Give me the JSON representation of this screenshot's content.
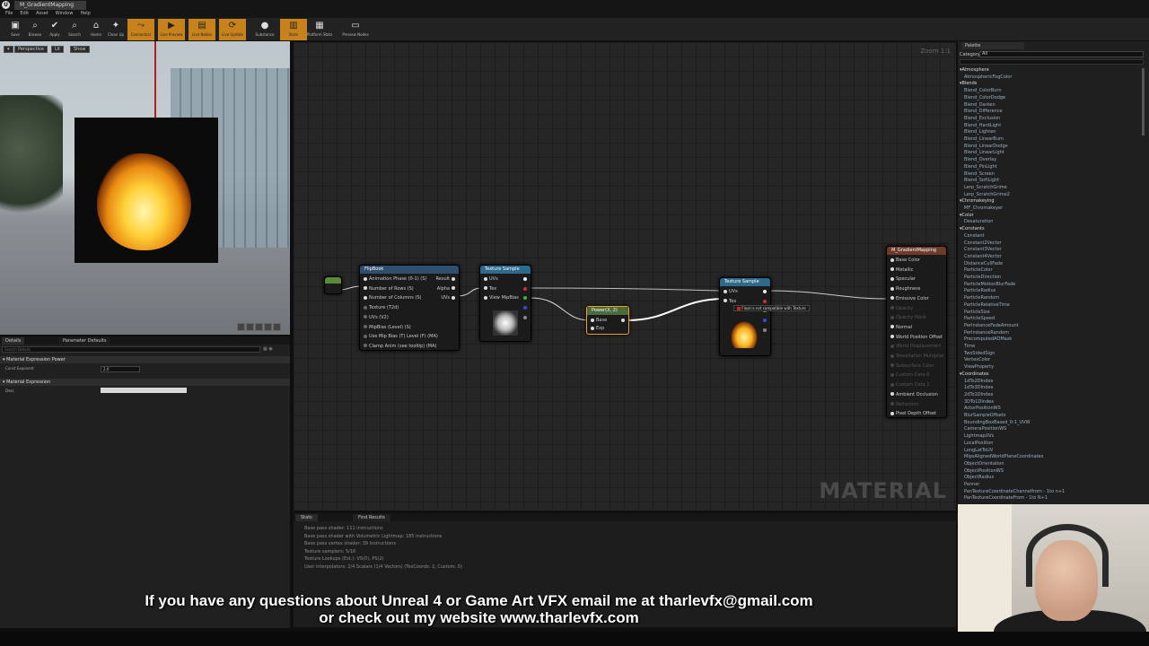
{
  "window": {
    "tab_title": "M_GradientMapping"
  },
  "menu": [
    "File",
    "Edit",
    "Asset",
    "Window",
    "Help"
  ],
  "toolbar": [
    {
      "label": "Save",
      "icon": "save-icon",
      "active": false
    },
    {
      "label": "Browse",
      "icon": "browse-icon",
      "active": false
    },
    {
      "label": "Apply",
      "icon": "apply-icon",
      "active": false
    },
    {
      "label": "Search",
      "icon": "search-icon",
      "active": false
    },
    {
      "label": "Home",
      "icon": "home-icon",
      "active": false
    },
    {
      "label": "Clean Up",
      "icon": "cleanup-icon",
      "active": false
    },
    {
      "label": "Connectors",
      "icon": "connectors-icon",
      "active": true
    },
    {
      "label": "Live Preview",
      "icon": "live-preview-icon",
      "active": true
    },
    {
      "label": "Live Nodes",
      "icon": "live-nodes-icon",
      "active": true
    },
    {
      "label": "Live Update",
      "icon": "live-update-icon",
      "active": true
    },
    {
      "label": "Substance",
      "icon": "substance-icon",
      "active": false
    },
    {
      "label": "Stats",
      "icon": "stats-icon",
      "active": true
    },
    {
      "label": "Platform Stats",
      "icon": "platform-stats-icon",
      "active": false
    },
    {
      "label": "Preview Nodes",
      "icon": "preview-nodes-icon",
      "active": false
    }
  ],
  "viewport": {
    "perspective": "Perspective",
    "lit": "Lit",
    "show": "Show"
  },
  "details": {
    "tab_details": "Details",
    "tab_params": "Parameter Defaults",
    "search_placeholder": "Search Details",
    "cat1": "Material Expression Power",
    "prop1_label": "Const Exponent",
    "prop1_value": "2.0",
    "cat2": "Material Expression",
    "prop2_label": "Desc"
  },
  "graph": {
    "zoom": "Zoom 1:1",
    "watermark": "MATERIAL",
    "flipbook": {
      "title": "FlipBook",
      "inputs": [
        "Animation Phase (0-1) (S)",
        "Number of Rows (S)",
        "Number of Columns (S)",
        "Texture (T2d)",
        "UVs (V2)",
        "MipBias (Level) (S)",
        "Use Mip Bias (T) Level (F) (MA)",
        "Clamp Anim (see tooltip) (MA)"
      ],
      "outputs": [
        "Result",
        "Alpha",
        "UVs"
      ]
    },
    "texsample1": {
      "title": "Texture Sample",
      "inputs": [
        "UVs",
        "Tex",
        "View MipBias"
      ]
    },
    "power": {
      "title": "Power(X, 2)",
      "inputs": [
        "Base",
        "Exp"
      ]
    },
    "texsample2": {
      "title": "Texture Sample",
      "inputs": [
        "UVs",
        "Tex"
      ],
      "error": "Float is not compatible with Texture"
    },
    "result": {
      "title": "M_GradientMapping",
      "pins": [
        "Base Color",
        "Metallic",
        "Specular",
        "Roughness",
        "Emissive Color",
        "Opacity",
        "Opacity Mask",
        "Normal",
        "World Position Offset",
        "World Displacement",
        "Tessellation Multiplier",
        "Subsurface Color",
        "Custom Data 0",
        "Custom Data 1",
        "Ambient Occlusion",
        "Refraction",
        "Pixel Depth Offset"
      ]
    }
  },
  "stats": {
    "tab_stats": "Stats",
    "tab_find": "Find Results",
    "lines": [
      "Base pass shader: 111 instructions",
      "Base pass shader with Volumetric Lightmap: 185 instructions",
      "Base pass vertex shader: 39 instructions",
      "Texture samplers: 5/16",
      "Texture Lookups (Est.): VS(0), PS(2)",
      "User interpolators: 2/4 Scalars (1/4 Vectors) (TexCoords: 2, Custom: 0)"
    ]
  },
  "palette": {
    "tab": "Palette",
    "category_label": "Category",
    "category_value": "All",
    "items": [
      {
        "t": "cat",
        "label": "Atmosphere"
      },
      {
        "t": "item",
        "label": "AtmosphericFogColor"
      },
      {
        "t": "cat",
        "label": "Blends"
      },
      {
        "t": "item",
        "label": "Blend_ColorBurn"
      },
      {
        "t": "item",
        "label": "Blend_ColorDodge"
      },
      {
        "t": "item",
        "label": "Blend_Darken"
      },
      {
        "t": "item",
        "label": "Blend_Difference"
      },
      {
        "t": "item",
        "label": "Blend_Exclusion"
      },
      {
        "t": "item",
        "label": "Blend_HardLight"
      },
      {
        "t": "item",
        "label": "Blend_Lighten"
      },
      {
        "t": "item",
        "label": "Blend_LinearBurn"
      },
      {
        "t": "item",
        "label": "Blend_LinearDodge"
      },
      {
        "t": "item",
        "label": "Blend_LinearLight"
      },
      {
        "t": "item",
        "label": "Blend_Overlay"
      },
      {
        "t": "item",
        "label": "Blend_PinLight"
      },
      {
        "t": "item",
        "label": "Blend_Screen"
      },
      {
        "t": "item",
        "label": "Blend_SoftLight"
      },
      {
        "t": "item",
        "label": "Lerp_ScratchGrime"
      },
      {
        "t": "item",
        "label": "Lerp_ScratchGrime2"
      },
      {
        "t": "cat",
        "label": "Chromakeying"
      },
      {
        "t": "item",
        "label": "MF_Chromakeyer"
      },
      {
        "t": "cat",
        "label": "Color"
      },
      {
        "t": "item",
        "label": "Desaturation"
      },
      {
        "t": "cat",
        "label": "Constants"
      },
      {
        "t": "item",
        "label": "Constant"
      },
      {
        "t": "item",
        "label": "Constant2Vector"
      },
      {
        "t": "item",
        "label": "Constant3Vector"
      },
      {
        "t": "item",
        "label": "Constant4Vector"
      },
      {
        "t": "item",
        "label": "DistanceCullFade"
      },
      {
        "t": "item",
        "label": "ParticleColor"
      },
      {
        "t": "item",
        "label": "ParticleDirection"
      },
      {
        "t": "item",
        "label": "ParticleMotionBlurFade"
      },
      {
        "t": "item",
        "label": "ParticleRadius"
      },
      {
        "t": "item",
        "label": "ParticleRandom"
      },
      {
        "t": "item",
        "label": "ParticleRelativeTime"
      },
      {
        "t": "item",
        "label": "ParticleSize"
      },
      {
        "t": "item",
        "label": "ParticleSpeed"
      },
      {
        "t": "item",
        "label": "PerInstanceFadeAmount"
      },
      {
        "t": "item",
        "label": "PerInstanceRandom"
      },
      {
        "t": "item",
        "label": "PrecomputedAOMask"
      },
      {
        "t": "item",
        "label": "Time"
      },
      {
        "t": "item",
        "label": "TwoSidedSign"
      },
      {
        "t": "item",
        "label": "VertexColor"
      },
      {
        "t": "item",
        "label": "ViewProperty"
      },
      {
        "t": "cat",
        "label": "Coordinates"
      },
      {
        "t": "item",
        "label": "1dTo2DIndex"
      },
      {
        "t": "item",
        "label": "1dTo3DIndex"
      },
      {
        "t": "item",
        "label": "2dTo1DIndex"
      },
      {
        "t": "item",
        "label": "3DTo1DIndex"
      },
      {
        "t": "item",
        "label": "ActorPositionWS"
      },
      {
        "t": "item",
        "label": "BlurSampleOffsets"
      },
      {
        "t": "item",
        "label": "BoundingBoxBased_0-1_UVW"
      },
      {
        "t": "item",
        "label": "CameraPositionWS"
      },
      {
        "t": "item",
        "label": "LightmapUVs"
      },
      {
        "t": "item",
        "label": "LocalPosition"
      },
      {
        "t": "item",
        "label": "LongLatToUV"
      },
      {
        "t": "item",
        "label": "MipsAlignedWorldPlaneCoordinates"
      },
      {
        "t": "item",
        "label": "ObjectOrientation"
      },
      {
        "t": "item",
        "label": "ObjectPositionWS"
      },
      {
        "t": "item",
        "label": "ObjectRadius"
      },
      {
        "t": "item",
        "label": "Panner"
      },
      {
        "t": "item",
        "label": "PanTextureCoordinateChannelfrom - 1to n+1"
      },
      {
        "t": "item",
        "label": "PanTextureCoordinateFrom - 1to N+1"
      }
    ]
  },
  "caption": {
    "line1": "If you have any questions about Unreal 4 or Game Art VFX email me at tharlevfx@gmail.com",
    "line2": "or check out my website www.tharlevfx.com"
  }
}
